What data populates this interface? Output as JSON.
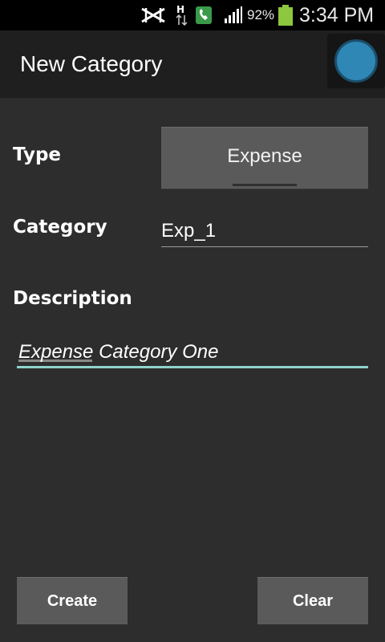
{
  "status_bar": {
    "battery_percent": "92%",
    "time": "3:34 PM",
    "icons": [
      "no-sim-icon",
      "hspa-data-icon",
      "phone-app-icon",
      "signal-icon",
      "battery-icon"
    ]
  },
  "action_bar": {
    "title": "New Category",
    "avatar_color": "#2f87b5"
  },
  "form": {
    "type_label": "Type",
    "type_value": "Expense",
    "category_label": "Category",
    "category_value": "Exp_1",
    "description_label": "Description",
    "description_value": "Expense Category One"
  },
  "buttons": {
    "create_label": "Create",
    "clear_label": "Clear"
  },
  "colors": {
    "focus_accent": "#8ed4cc",
    "background": "#2d2d2d"
  }
}
